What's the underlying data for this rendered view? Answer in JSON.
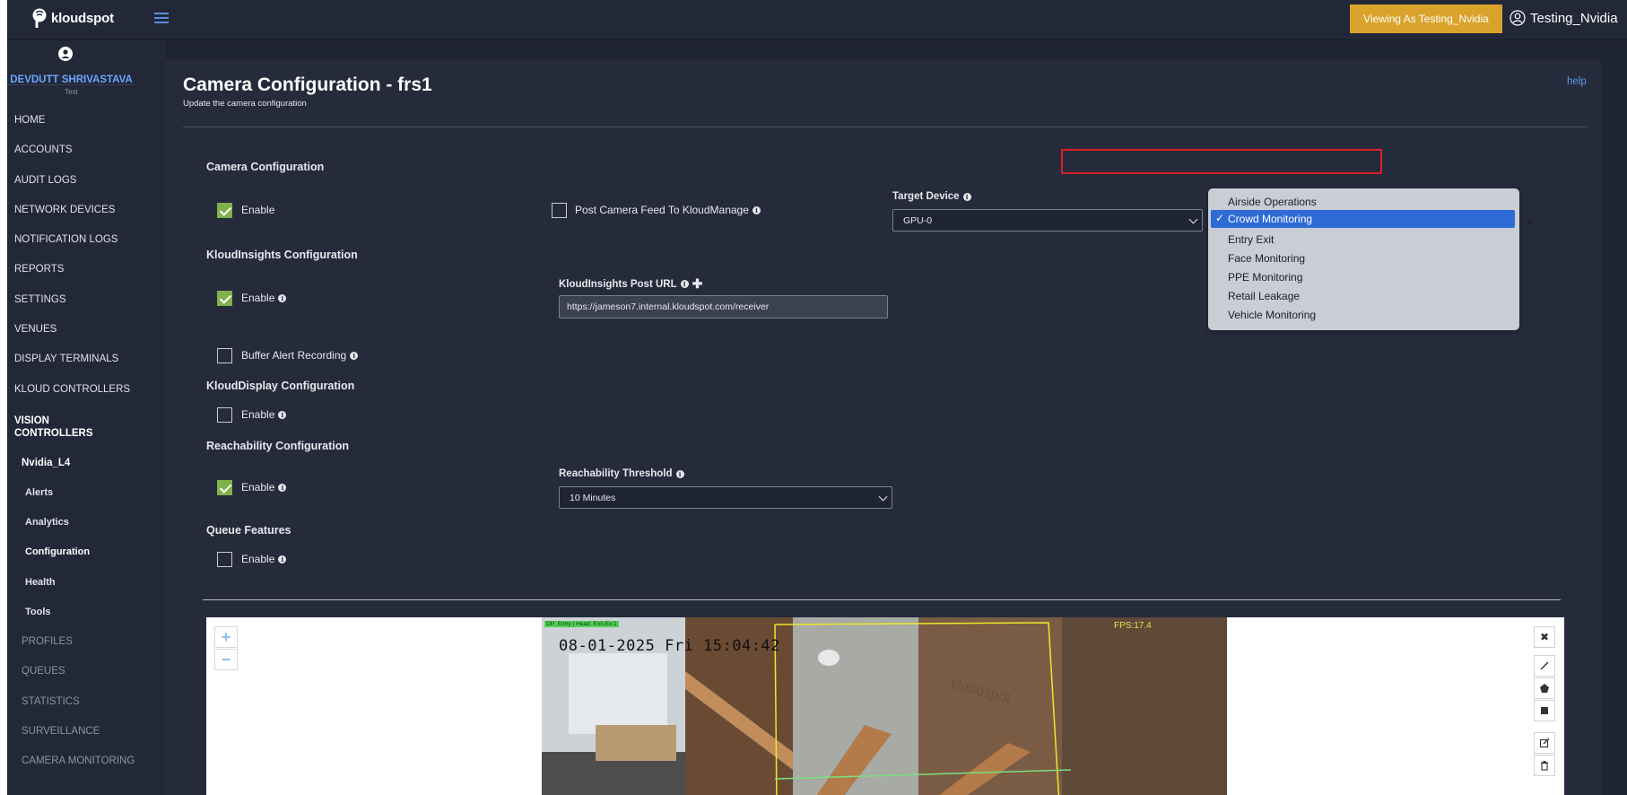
{
  "brand": {
    "name": "kloudspot"
  },
  "topbar": {
    "viewing_as": "Viewing As Testing_Nvidia",
    "user_name": "Testing_Nvidia"
  },
  "profile": {
    "name": "DEVDUTT SHRIVASTAVA",
    "role": "Test"
  },
  "sidebar": {
    "items": [
      "HOME",
      "ACCOUNTS",
      "AUDIT LOGS",
      "NETWORK DEVICES",
      "NOTIFICATION LOGS",
      "REPORTS",
      "SETTINGS",
      "VENUES",
      "DISPLAY TERMINALS",
      "KLOUD CONTROLLERS"
    ],
    "vision_controllers_line1": "VISION",
    "vision_controllers_line2": "CONTROLLERS",
    "device": "Nvidia_L4",
    "device_items": [
      "Alerts",
      "Analytics",
      "Configuration",
      "Health",
      "Tools"
    ],
    "muted_items": [
      "PROFILES",
      "QUEUES",
      "STATISTICS",
      "SURVEILLANCE",
      "CAMERA MONITORING"
    ]
  },
  "page": {
    "title": "Camera Configuration - frs1",
    "subtitle": "Update the camera configuration",
    "help": "help"
  },
  "camera_config": {
    "title": "Camera Configuration",
    "enable_label": "Enable",
    "enabled": true,
    "post_feed_label": "Post Camera Feed To KloudManage",
    "post_feed_checked": false,
    "target_device_label": "Target Device",
    "target_device_value": "GPU-0"
  },
  "kloudinsights": {
    "title": "KloudInsights Configuration",
    "enable_label": "Enable",
    "enabled": true,
    "post_url_label": "KloudInsights Post URL",
    "post_url_value": "https://jameson7.internal.kloudspot.com/receiver",
    "buffer_label": "Buffer Alert Recording",
    "buffer_checked": false
  },
  "kloudisplay": {
    "title": "KloudDisplay Configuration",
    "enable_label": "Enable",
    "enabled": false
  },
  "reachability": {
    "title": "Reachability Configuration",
    "enable_label": "Enable",
    "enabled": true,
    "threshold_label": "Reachability Threshold",
    "threshold_value": "10 Minutes"
  },
  "queue": {
    "title": "Queue Features",
    "enable_label": "Enable",
    "enabled": false
  },
  "use_case_dropdown": {
    "options": [
      "Airside Operations",
      "Crowd Monitoring",
      "Entry Exit",
      "Face Monitoring",
      "PPE Monitoring",
      "Retail Leakage",
      "Vehicle Monitoring"
    ],
    "selected": "Crowd Monitoring",
    "selected_check": "✓"
  },
  "video": {
    "timestamp": "08-01-2025 Fri 15:04:42",
    "overlay_dp": "DP: Entry | Head: En0,Ex:1",
    "fps": "FPS:17.4",
    "zoom_in": "+",
    "zoom_out": "−"
  },
  "colors": {
    "accent_button": "#d9a32b",
    "checkbox_on": "#7fb24a",
    "link": "#5b9cf0",
    "dropdown_selected": "#2f6bd6",
    "highlight_box": "#d6202a"
  }
}
